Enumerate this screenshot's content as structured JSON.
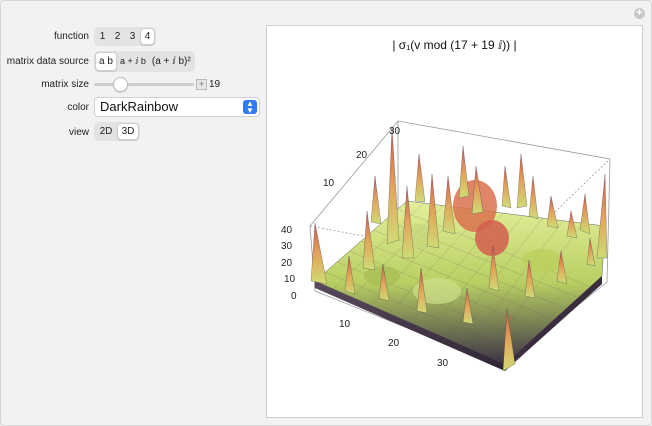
{
  "controls": {
    "function": {
      "label": "function",
      "options": [
        "1",
        "2",
        "3",
        "4"
      ],
      "selected": "4"
    },
    "matrix_data_source": {
      "label": "matrix data source",
      "options": [
        "a b",
        "a + ⅈ b",
        "(a + ⅈ b)²"
      ],
      "selected": "a b"
    },
    "matrix_size": {
      "label": "matrix size",
      "value": "19"
    },
    "color": {
      "label": "color",
      "value": "DarkRainbow"
    },
    "view": {
      "label": "view",
      "options": [
        "2D",
        "3D"
      ],
      "selected": "3D"
    }
  },
  "plot": {
    "title": "| σ₁(v mod (17 + 19 ⅈ)) |",
    "z_ticks": [
      "40",
      "30",
      "20",
      "10",
      "0"
    ],
    "back_ticks": [
      "30",
      "20",
      "10"
    ],
    "front_x_ticks": [
      "10",
      "20",
      "30"
    ]
  },
  "colors": {
    "accent": "#2f7cf6",
    "surface_low": "#3a2b3e",
    "surface_mid": "#c8d86a",
    "surface_high": "#d8534a"
  }
}
